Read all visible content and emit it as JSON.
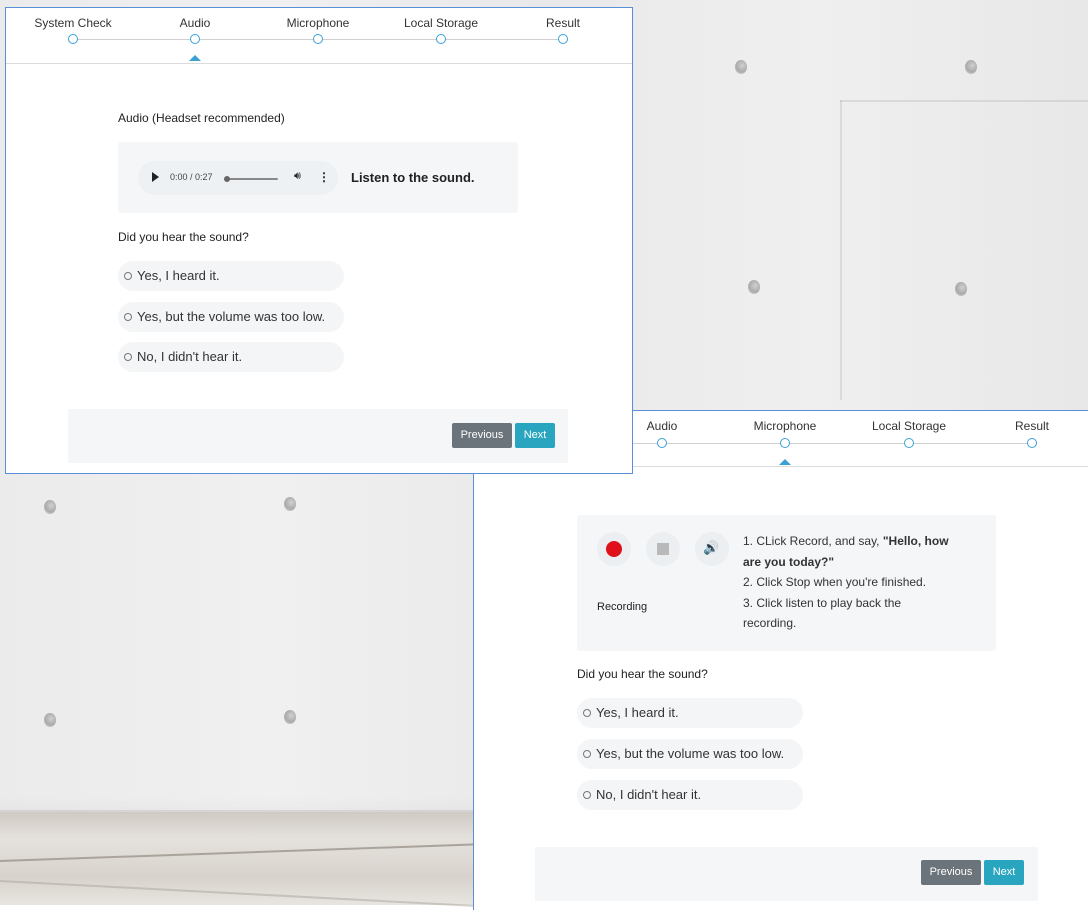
{
  "colors": {
    "accent": "#3ba0d6",
    "next_button": "#2aa5c0",
    "previous_button": "#6b747b",
    "record_red": "#e0101a"
  },
  "panel_audio": {
    "steps": [
      "System Check",
      "Audio",
      "Microphone",
      "Local Storage",
      "Result"
    ],
    "active_step": "Audio",
    "section_label": "Audio (Headset recommended)",
    "player": {
      "time": "0:00 / 0:27"
    },
    "player_hint": "Listen to the sound.",
    "question": "Did you hear the sound?",
    "options": [
      "Yes, I heard it.",
      "Yes, but the volume was too low.",
      "No, I didn't hear it."
    ],
    "previous_label": "Previous",
    "next_label": "Next"
  },
  "panel_microphone": {
    "steps": [
      "Audio",
      "Microphone",
      "Local Storage",
      "Result"
    ],
    "active_step": "Microphone",
    "recording_label": "Recording",
    "instructions": {
      "line1_prefix": "1. CLick Record, and say, ",
      "line1_quote_a": "\"Hello, how",
      "line1_quote_b": "are you today?\"",
      "line2": "2. Click Stop when you're finished.",
      "line3a": "3. Click listen to play back the",
      "line3b": "recording."
    },
    "question": "Did you hear the sound?",
    "options": [
      "Yes, I heard it.",
      "Yes, but the volume was too low.",
      "No, I didn't hear it."
    ],
    "previous_label": "Previous",
    "next_label": "Next"
  }
}
